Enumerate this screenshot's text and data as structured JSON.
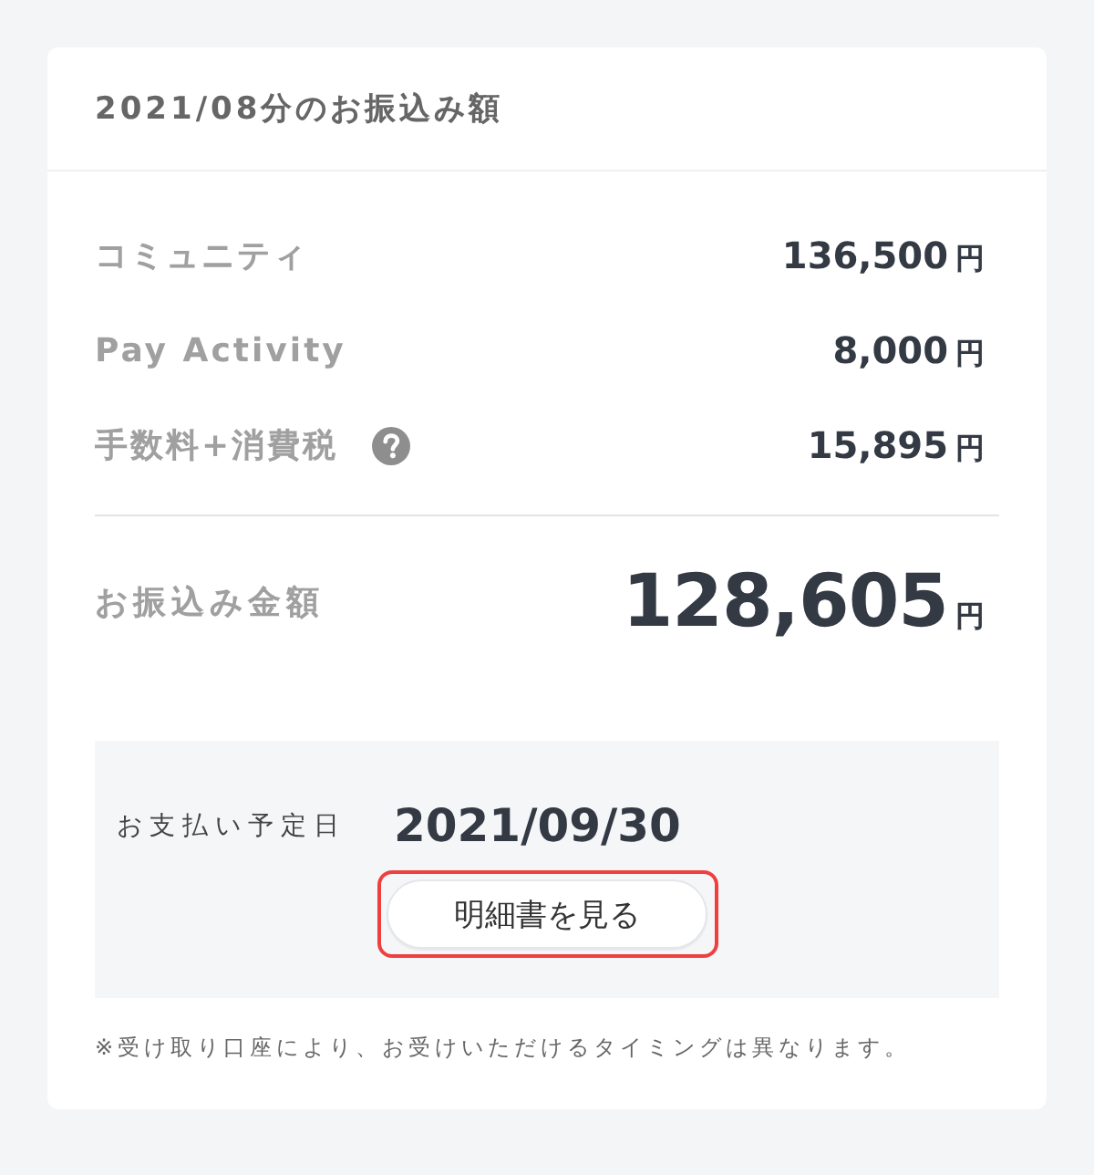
{
  "header": {
    "title": "2021/08分のお振込み額"
  },
  "items": [
    {
      "label": "コミュニティ",
      "amount": "136,500",
      "unit": "円",
      "help": false
    },
    {
      "label": "Pay Activity",
      "amount": "8,000",
      "unit": "円",
      "help": false
    },
    {
      "label": "手数料+消費税",
      "amount": "15,895",
      "unit": "円",
      "help": true
    }
  ],
  "total": {
    "label": "お振込み金額",
    "amount": "128,605",
    "unit": "円"
  },
  "payment": {
    "label": "お支払い予定日",
    "date": "2021/09/30",
    "button": {
      "label": "明細書を見る",
      "highlighted": true
    }
  },
  "note": "※受け取り口座により、お受けいただけるタイミングは異なります。"
}
